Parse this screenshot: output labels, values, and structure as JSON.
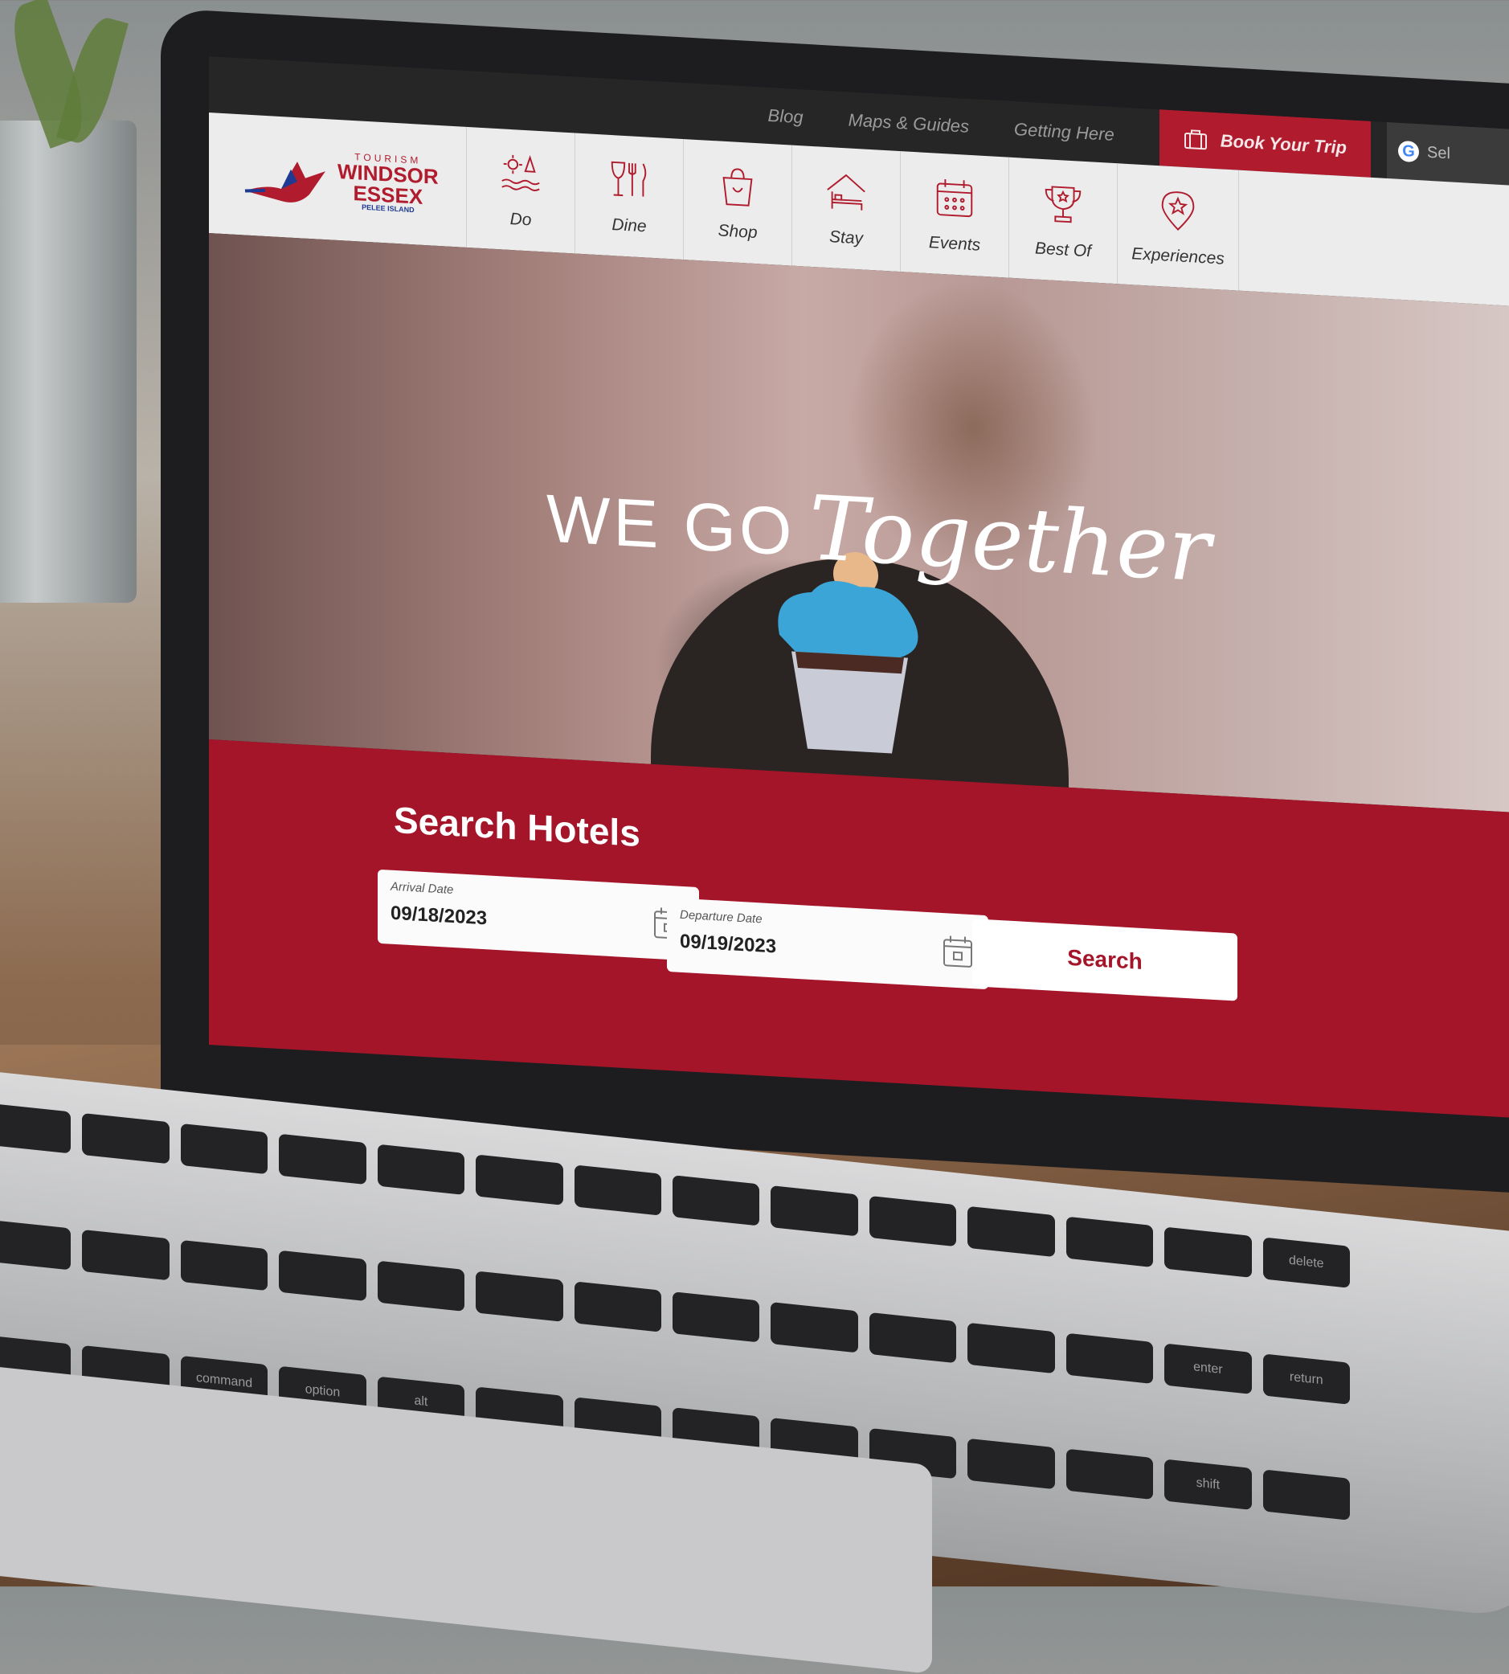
{
  "topnav": {
    "links": [
      "Blog",
      "Maps & Guides",
      "Getting Here"
    ],
    "book_trip": "Book Your Trip",
    "language_select": "Sel"
  },
  "logo": {
    "tourism": "TOURISM",
    "line1": "WINDSOR",
    "line2": "ESSEX",
    "line3": "PELEE ISLAND"
  },
  "mainnav": {
    "items": [
      {
        "label": "Do",
        "icon": "sun-trees-waves-icon"
      },
      {
        "label": "Dine",
        "icon": "glass-fork-knife-icon"
      },
      {
        "label": "Shop",
        "icon": "shopping-bag-icon"
      },
      {
        "label": "Stay",
        "icon": "house-bed-icon"
      },
      {
        "label": "Events",
        "icon": "calendar-icon"
      },
      {
        "label": "Best Of",
        "icon": "trophy-icon"
      },
      {
        "label": "Experiences",
        "icon": "map-pin-star-icon"
      }
    ]
  },
  "hero": {
    "headline_part1": "WE GO",
    "headline_part2": "Together"
  },
  "search": {
    "title": "Search Hotels",
    "arrival_label": "Arrival Date",
    "arrival_value": "09/18/2023",
    "departure_label": "Departure Date",
    "departure_value": "09/19/2023",
    "button_label": "Search"
  },
  "keyboard": {
    "keys": [
      "command",
      "option",
      "alt",
      "shift",
      "return",
      "enter",
      "delete"
    ]
  },
  "colors": {
    "brand_red": "#a4152a",
    "topbar": "#262626",
    "navbar": "#ececec"
  }
}
